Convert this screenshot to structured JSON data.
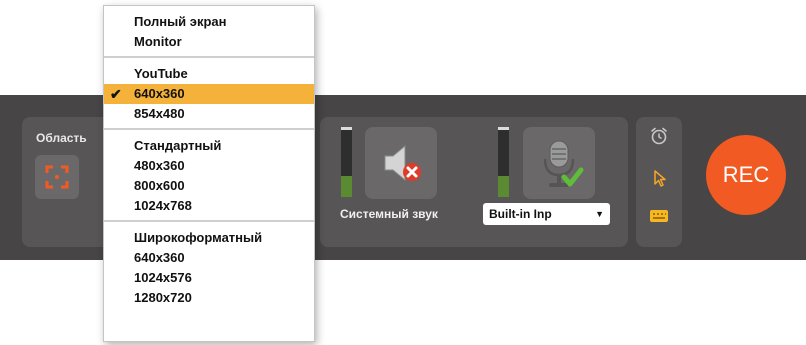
{
  "area": {
    "title": "Область"
  },
  "audio": {
    "system_label": "Системный звук",
    "mic_value": "Built-in Inp",
    "system_level": 0.3,
    "mic_level": 0.3
  },
  "rec": {
    "label": "REC"
  },
  "colors": {
    "accent": "#f15a22",
    "highlight": "#f5b23a",
    "ok": "#5fbd3a",
    "error": "#e03a2a",
    "bar": "#474545"
  },
  "menu": {
    "groups": [
      {
        "items": [
          "Полный экран",
          "Monitor"
        ]
      },
      {
        "items": [
          "YouTube",
          "640x360",
          "854x480"
        ]
      },
      {
        "items": [
          "Стандартный",
          "480x360",
          "800x600",
          "1024x768"
        ]
      },
      {
        "items": [
          "Широкоформатный",
          "640x360",
          "1024x576",
          "1280x720"
        ]
      }
    ],
    "selected": "640x360",
    "check": "✔"
  },
  "tools": {
    "icons": [
      "alarm-clock-icon",
      "cursor-icon",
      "keyboard-icon"
    ]
  }
}
